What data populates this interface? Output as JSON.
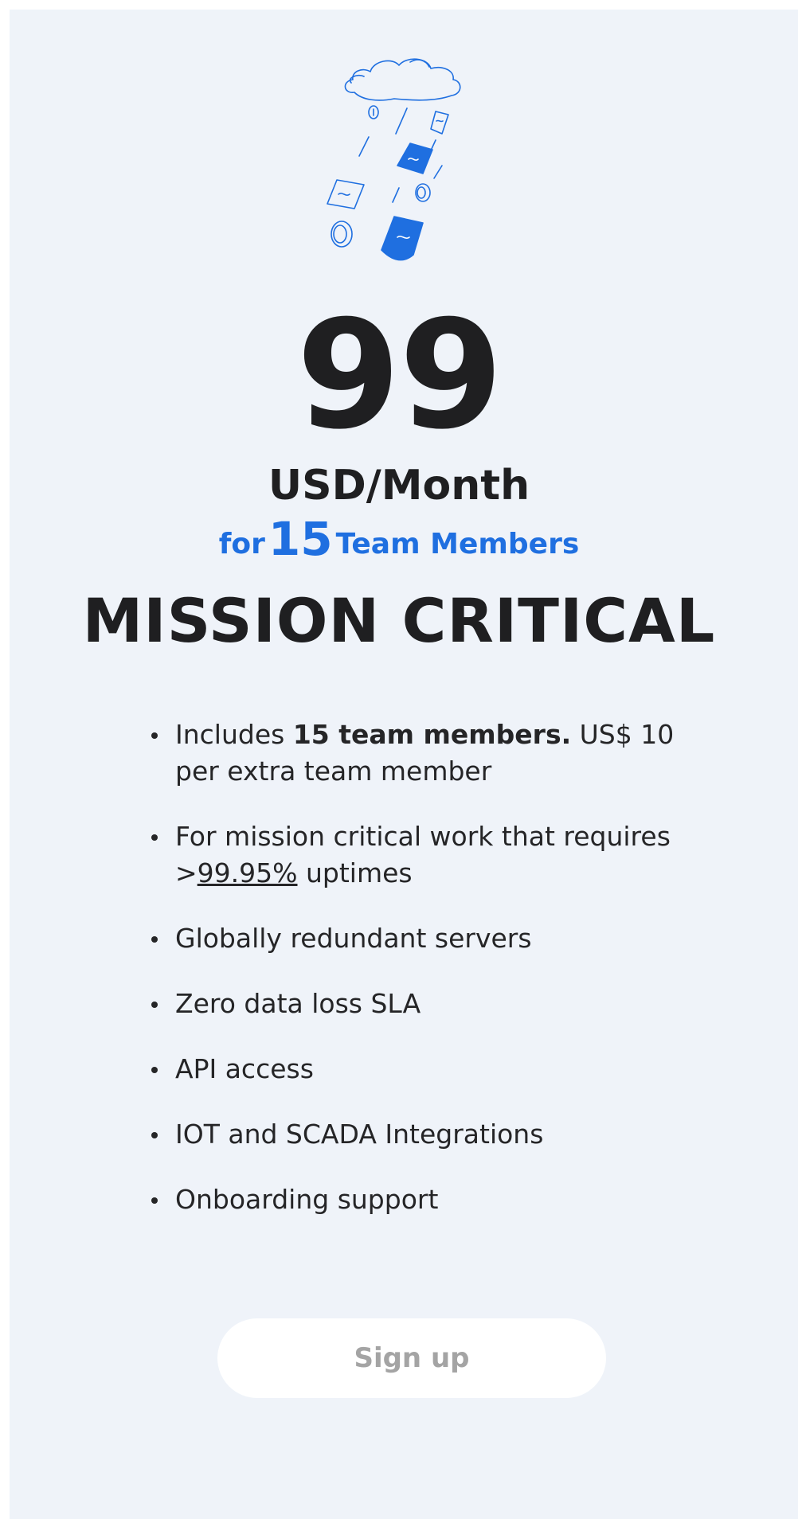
{
  "plan": {
    "price": "99",
    "period": "USD/Month",
    "members_prefix": "for",
    "members_count": "15",
    "members_suffix": "Team Members",
    "name": "MISSION CRITICAL"
  },
  "features": {
    "f1": {
      "a": "Includes ",
      "b": "15 team members.",
      "c": " US$ 10 per extra team member"
    },
    "f2": {
      "a": "For mission critical work that requires >",
      "b": "99.95%",
      "c": " uptimes"
    },
    "f3": "Globally redundant servers",
    "f4": "Zero data loss SLA",
    "f5": "API access",
    "f6": "IOT and SCADA Integrations",
    "f7": "Onboarding support"
  },
  "cta": {
    "label": "Sign up"
  },
  "illustration": {
    "name": "money-rain-icon"
  },
  "colors": {
    "accent": "#1f6fe0",
    "background": "#eff3f9",
    "text": "#1f1f21"
  }
}
